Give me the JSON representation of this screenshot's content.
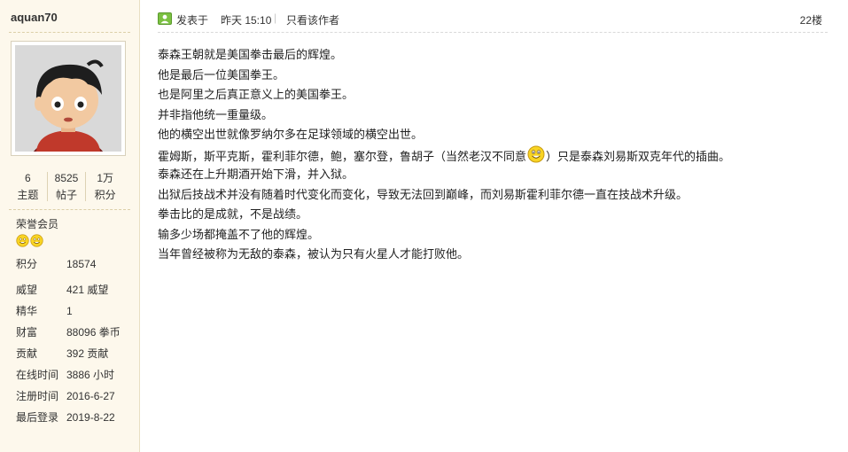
{
  "user": {
    "username": "aquan70",
    "stats": [
      {
        "value": "6",
        "label": "主题"
      },
      {
        "value": "8525",
        "label": "帖子"
      },
      {
        "value": "1万",
        "label": "积分"
      }
    ],
    "group": "荣誉会员",
    "medals": [
      "smiley-medal-icon",
      "smiley-medal-icon"
    ],
    "points_label": "积分",
    "points_value": "18574",
    "details": [
      {
        "key": "威望",
        "value": "421 威望"
      },
      {
        "key": "精华",
        "value": "1"
      },
      {
        "key": "财富",
        "value": "88096 拳币"
      },
      {
        "key": "贡献",
        "value": "392 贡献"
      },
      {
        "key": "在线时间",
        "value": "3886 小时"
      },
      {
        "key": "注册时间",
        "value": "2016-6-27"
      },
      {
        "key": "最后登录",
        "value": "2019-8-22"
      }
    ]
  },
  "post": {
    "posted_label": "发表于",
    "posted_time": "昨天 15:10",
    "separator": "|",
    "author_only_link": "只看该作者",
    "floor": "22楼",
    "lines": [
      "泰森王朝就是美国拳击最后的辉煌。",
      "他是最后一位美国拳王。",
      "也是阿里之后真正意义上的美国拳王。",
      "并非指他统一重量级。",
      "他的横空出世就像罗纳尔多在足球领域的横空出世。",
      "",
      "泰森还在上升期酒开始下滑，并入狱。",
      "出狱后技战术并没有随着时代变化而变化，导致无法回到巅峰，而刘易斯霍利菲尔德一直在技战术升级。",
      "拳击比的是成就，不是战绩。",
      "输多少场都掩盖不了他的辉煌。",
      "当年曾经被称为无敌的泰森，被认为只有火星人才能打败他。"
    ],
    "line6_before": "霍姆斯，斯平克斯，霍利菲尔德，鲍，塞尔登，鲁胡子（当然老汉不同意",
    "line6_emoji": "smiley-icon",
    "line6_after": "）只是泰森刘易斯双克年代的插曲。"
  },
  "colors": {
    "sidebar_bg": "#fdf8ec",
    "online_green": "#7cc142",
    "smiley_yellow": "#f9d423"
  }
}
